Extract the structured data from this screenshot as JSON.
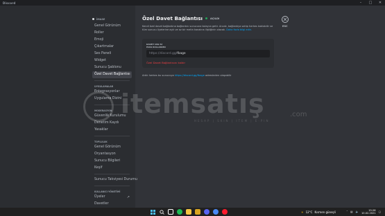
{
  "window": {
    "app_name": "Discord",
    "controls": [
      "–",
      "□",
      "✕"
    ]
  },
  "sidebar": {
    "server_name": "İMASE",
    "group1": [
      "Genel Görünüm",
      "Roller",
      "Emoji",
      "Çıkartmalar",
      "Ses Paneli",
      "Widget",
      "Sunucu Şablonu",
      "Özel Davet Bağlantısı"
    ],
    "active_item": "Özel Davet Bağlantısı",
    "apps_header": "UYGULAMALAR",
    "apps": [
      "Entegrasyonlar",
      "Uygulama Dizini"
    ],
    "moderation_header": "MODERASYON",
    "moderation": [
      "Güvenlik Kurulumu",
      "Denetim Kaydı",
      "Yasaklar"
    ],
    "community_header": "TOPLULUK",
    "community": [
      "Genel Görünüm",
      "Oryantasyon",
      "Sunucu Bilgileri",
      "Keşif"
    ],
    "subscription": "Sunucu Takviyesi Durumu",
    "user_mgmt_header": "KULLANICI YÖNETİMİ",
    "user_mgmt": [
      "Üyeler",
      "Davetler"
    ]
  },
  "main": {
    "title": "Özel Davet Bağlantısı",
    "status": "AÇILDI",
    "description": "Kendi özel davet bağlantına bağlantını sunucuna kolayca getir. Ancak, bağlantıya sahip herkes katılabilir ve tüm sunucu üyelerine açık ve az bir metin kanalına iliştiğinin olacak.",
    "description_link": "Daha fazla bilgi edin.",
    "card_label_line1": "DAVET URL'Sİ",
    "card_label_line2": "HIAS KULLANIMI",
    "url_prefix": "https://discord.gg/",
    "url_code": "fbage",
    "remove_link": "Özel Davet Bağlantısını kaldır",
    "invite_note_prefix": "Artık herkes bu sunucuya ",
    "invite_note_link": "https://discord.gg/fbage",
    "invite_note_suffix": " adresinden ulaşabilir",
    "close_icon": "close-icon",
    "esc_label": "ESC"
  },
  "watermark": {
    "brand": "itemsatış",
    "domain": ".com",
    "tagline": "HESAP | SKIN | ITEM | E-PIN"
  },
  "taskbar": {
    "weather": "12°C",
    "weather_text": "Kısmen güneşli",
    "time": "15:26",
    "date": "10.02.2021"
  },
  "colors": {
    "accent_link": "#00a8fc",
    "online": "#23a55a",
    "danger": "#f23f43",
    "active_bg": "#404249"
  }
}
